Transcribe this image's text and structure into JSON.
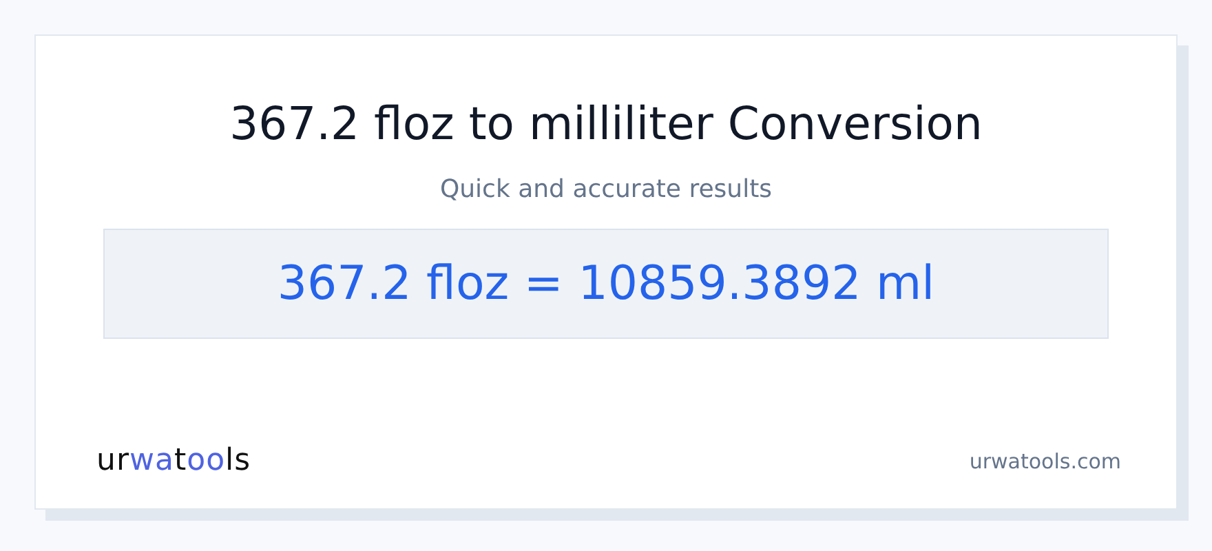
{
  "title": "367.2 floz to milliliter Conversion",
  "subtitle": "Quick and accurate results",
  "result": "367.2 floz = 10859.3892 ml",
  "logo": [
    {
      "text": "ur",
      "accent": false
    },
    {
      "text": "wa",
      "accent": true
    },
    {
      "text": "t",
      "accent": false
    },
    {
      "text": "oo",
      "accent": true
    },
    {
      "text": "ls",
      "accent": false
    }
  ],
  "site": "urwatools.com"
}
